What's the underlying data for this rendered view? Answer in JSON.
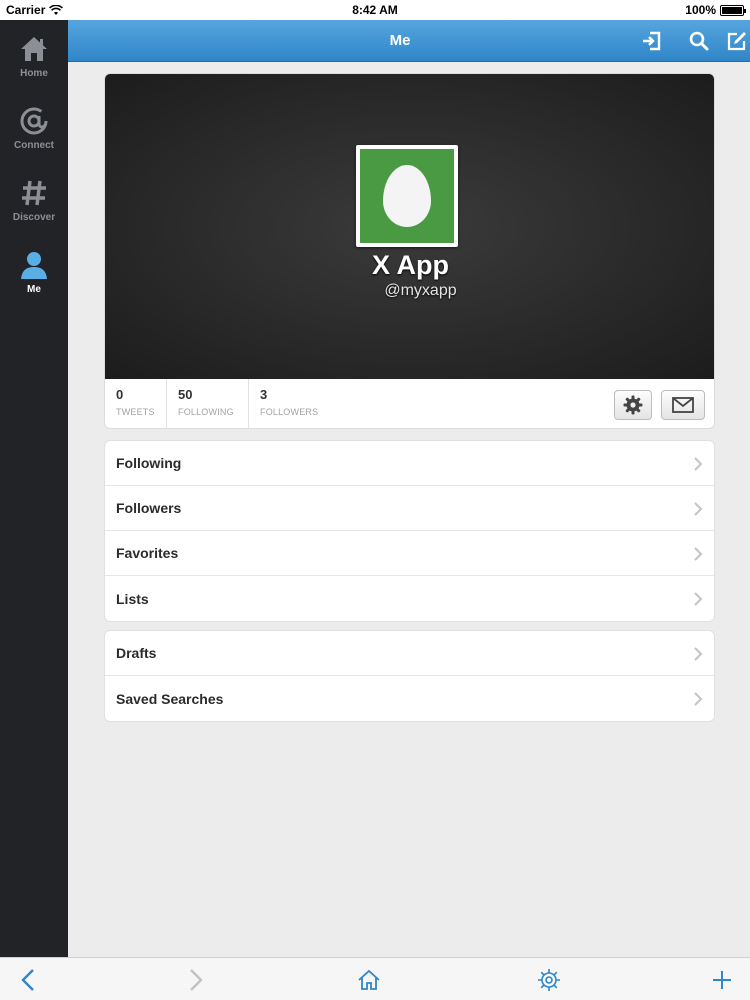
{
  "status_bar": {
    "carrier": "Carrier",
    "time": "8:42 AM",
    "battery": "100%"
  },
  "sidebar": {
    "items": [
      {
        "label": "Home",
        "icon": "home-icon",
        "active": false
      },
      {
        "label": "Connect",
        "icon": "at-icon",
        "active": false
      },
      {
        "label": "Discover",
        "icon": "hash-icon",
        "active": false
      },
      {
        "label": "Me",
        "icon": "person-icon",
        "active": true
      }
    ]
  },
  "navbar": {
    "title": "Me",
    "icons": [
      "sign-out-icon",
      "search-icon",
      "compose-icon"
    ]
  },
  "profile": {
    "name": "X App",
    "handle": "@myxapp",
    "avatar_icon": "egg-icon",
    "stats": [
      {
        "value": "0",
        "label": "TWEETS"
      },
      {
        "value": "50",
        "label": "FOLLOWING"
      },
      {
        "value": "3",
        "label": "FOLLOWERS"
      }
    ],
    "actions": [
      "gear-icon",
      "envelope-icon"
    ]
  },
  "menu_primary": [
    "Following",
    "Followers",
    "Favorites",
    "Lists"
  ],
  "menu_secondary": [
    "Drafts",
    "Saved Searches"
  ],
  "toolbar": {
    "icons": [
      "back-icon",
      "forward-icon",
      "home-icon",
      "settings-icon",
      "plus-icon"
    ]
  },
  "colors": {
    "nav_blue": "#2f86c8",
    "sidebar_dark": "#222327",
    "accent_blue": "#2f86c8",
    "avatar_green": "#4a9a43"
  }
}
